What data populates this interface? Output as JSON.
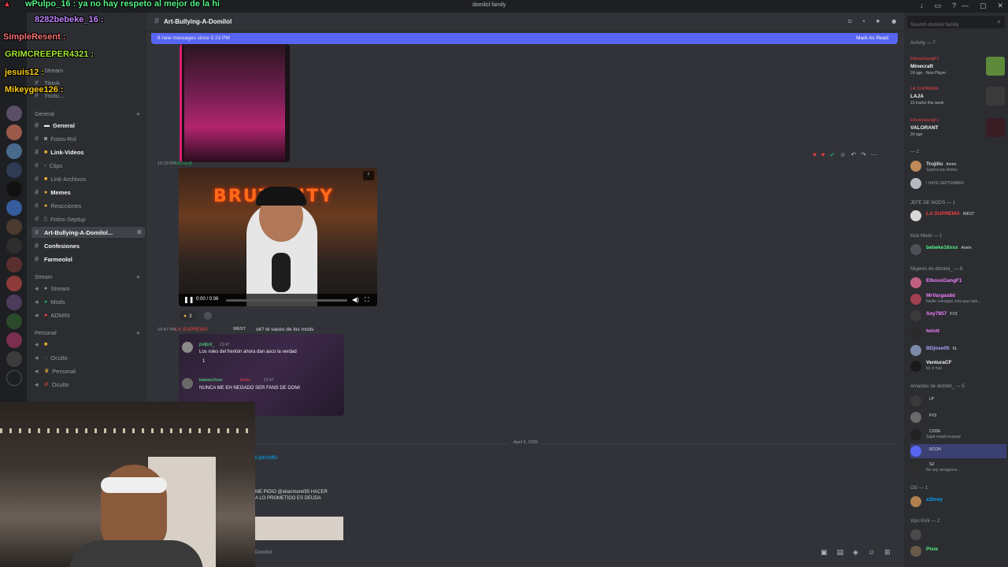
{
  "window": {
    "title": "domilol family"
  },
  "overlay": {
    "top_chat": "wPulpo_16 : ya no hay respeto al mejor de la hi",
    "handle1": "8282bebeke_16 :",
    "handle2": "SimpleResent :",
    "handle3": "GRIMCREEPER4321 :",
    "handle4": "jesuis12 :",
    "handle5": "Mikeygee126 :"
  },
  "channels": {
    "partial_top": [
      "Stream",
      "Tiktok",
      "Youtu..."
    ],
    "general_cat": "General",
    "items": [
      {
        "label": "General",
        "bold": true
      },
      {
        "label": "Fotos-Rol"
      },
      {
        "label": "Link-Videos",
        "bold": true
      },
      {
        "label": "Clips"
      },
      {
        "label": "Link-Archivos"
      },
      {
        "label": "Memes",
        "bold": true
      },
      {
        "label": "Reacciones"
      },
      {
        "label": "Fotos-Septup"
      },
      {
        "label": "Art-Bullying-A-Domilol...",
        "active": true
      },
      {
        "label": "Confesiones",
        "bold": true
      },
      {
        "label": "Farmeolol",
        "bold": true
      }
    ],
    "stream_cat": "Stream",
    "stream_items": [
      "Stream",
      "Mods",
      "ADMIN"
    ],
    "personal_cat": "Personal",
    "personal_items": [
      "",
      "Oculto",
      "Personal",
      "Oculto"
    ]
  },
  "header": {
    "channel_name": "Art-Bullying-A-Domilol"
  },
  "newbar": {
    "text": "6 new messages since 5:23 PM",
    "action": "Mark As Read"
  },
  "messages": {
    "m1_time": "10:19 PM",
    "m1_user": "lolcravjt",
    "video_title": "BRUTALITY",
    "video_time": "0:00 / 0:36",
    "video_progress": 0.0,
    "reaction_count": "3",
    "m2_time": "10:47 PM",
    "m2_user": "LA SUPREMA",
    "m2_tag": "WEST",
    "m2_text": "ok? el vaceo de los mods",
    "embed_user1": "pulpol_",
    "embed_time1": "21:47",
    "embed_text1": "Los roles del frentón ahora dan asco la verdad",
    "embed_react": "1",
    "embed_user2": "bebeke16xxx",
    "embed_badge2": "Amén",
    "embed_time2": "21:47",
    "embed_text2": "NUNCA ME EH NEGADO SER FANS DE DOMI",
    "date_divider": "April 6, 2026",
    "partial_link": "lUphVM5/",
    "partial_text1": "ME PIDIO @elianmorel55 HACER",
    "partial_text2": "A LO PROMETIDO ES DEUDA",
    "partial_bottom": "Domilol"
  },
  "members": {
    "search_placeholder": "Search domilol family",
    "activity_cat": "Activity — 7",
    "activities": [
      {
        "name": "ElbossGangF1",
        "game": "Minecraft",
        "sub": "2d ago · New Player",
        "color": "#5c8a3a"
      },
      {
        "name": "LA SUPREMA",
        "game": "LAJA",
        "sub": "15 tracks this week",
        "color": "#3a3a3a"
      },
      {
        "name": "ElbossGangF1",
        "game": "VALORANT",
        "sub": "2d ago",
        "color": "#f23f43"
      }
    ],
    "group1_cat": "— 2",
    "group1": [
      {
        "name": "Trujillo",
        "tag": "Amén",
        "status": "Supera tus limites",
        "color": "#dbdee1"
      },
      {
        "name": "",
        "tag": "",
        "status": "I HATE SEPTEMBER",
        "color": "#dbdee1"
      }
    ],
    "jefe_cat": "JEFE DE MODS — 1",
    "jefe": [
      {
        "name": "LA SUPREMA",
        "tag": "WEST",
        "color": "#f23f43"
      }
    ],
    "kick_cat": "Kick Mods — 1",
    "kick": [
      {
        "name": "bebeke16xxx",
        "tag": "Amén",
        "color": "#57f287"
      }
    ],
    "mujeres_cat": "Mujeres de domilol_ — 6",
    "mujeres": [
      {
        "name": "ElbossGangF1",
        "status": "",
        "color": "#f47fff"
      },
      {
        "name": "MrVargas8d",
        "status": "Nadie consigue sola que vale...",
        "color": "#f47fff"
      },
      {
        "name": "Soy7857",
        "tag": "FV3",
        "status": "",
        "color": "#f47fff"
      },
      {
        "name": "twixtt",
        "status": "",
        "color": "#f47fff"
      },
      {
        "name": "BDjose05",
        "tag": "KL",
        "status": "",
        "color": "#a7a7ff"
      },
      {
        "name": "VenturaCF",
        "status": "lol, k mal",
        "color": "#f2f3f5"
      }
    ],
    "amantes_cat": "Amantes de domilol_ — 5",
    "amantes": [
      {
        "name": "",
        "tag": "LP",
        "color": "#f23f43"
      },
      {
        "name": "",
        "tag": "FV3",
        "color": "#f23f43"
      },
      {
        "name": "",
        "tag": "CODE",
        "status": "Sapit install mussey",
        "color": "#f23f43"
      },
      {
        "name": "",
        "tag": "RCON",
        "color": "#f23f43",
        "highlight": true
      },
      {
        "name": "",
        "tag": "SZ",
        "status": "No soy arrogance...",
        "color": "#f23f43"
      }
    ],
    "og_cat": "OG — 1",
    "og": [
      {
        "name": "x2brey",
        "color": "#00a8fc"
      }
    ],
    "vips_cat": "Vips Kick — 2",
    "vips": [
      {
        "name": "",
        "color": "#57f287"
      },
      {
        "name": "Pixie",
        "color": "#57f287"
      }
    ]
  }
}
